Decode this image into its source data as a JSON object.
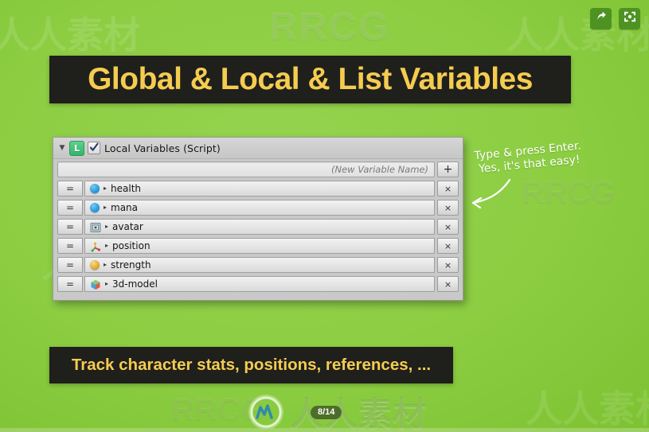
{
  "slide": {
    "title": "Global & Local & List Variables",
    "caption": "Track character stats, positions, references, ...",
    "page_indicator": "8/14",
    "background_color": "#8dce44",
    "banner_color": "#1f1f1c",
    "title_color": "#f5cc50"
  },
  "player_controls": {
    "share_label": "share-arrow",
    "fullscreen_label": "fullscreen"
  },
  "annotation": {
    "line1": "Type & press Enter.",
    "line2": "Yes, it's that easy!"
  },
  "inspector": {
    "foldout": "▼",
    "script_icon_letter": "L",
    "enabled": true,
    "title": "Local Variables (Script)",
    "new_variable_placeholder": "(New Variable Name)",
    "new_variable_value": "",
    "add_button_label": "+",
    "drag_handle_label": "=",
    "remove_button_label": "×",
    "expand_arrow": "▸",
    "variables": [
      {
        "name": "health",
        "icon": "float-icon",
        "icon_color": "#2b9fe0"
      },
      {
        "name": "mana",
        "icon": "float-icon",
        "icon_color": "#2b9fe0"
      },
      {
        "name": "avatar",
        "icon": "gameobject-icon",
        "icon_color": "#8fa3a8"
      },
      {
        "name": "position",
        "icon": "vector3-icon",
        "icon_color": "#d8b23a"
      },
      {
        "name": "strength",
        "icon": "int-icon",
        "icon_color": "#e3ad3a"
      },
      {
        "name": "3d-model",
        "icon": "prefab-cube-icon",
        "icon_color": "#4aa3dd"
      }
    ]
  },
  "watermarks": {
    "rrcg": "RRCG",
    "brand_cn": "人人素材",
    "ghost_cn": "人人素材"
  }
}
